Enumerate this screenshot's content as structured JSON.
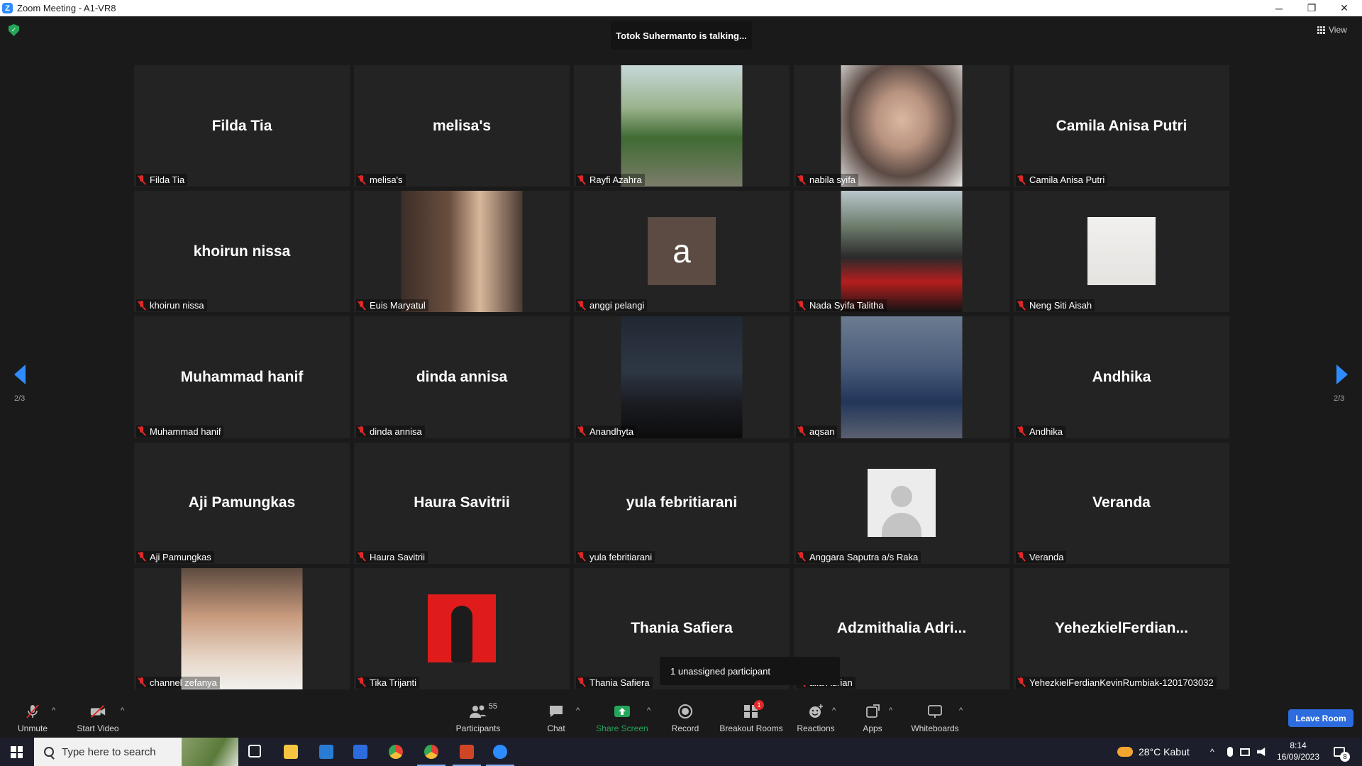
{
  "window": {
    "title": "Zoom Meeting - A1-VR8",
    "minimize_glyph": "─",
    "restore_glyph": "❐",
    "close_glyph": "✕"
  },
  "meeting": {
    "talking_banner": "Totok Suhermanto is talking...",
    "view_label": "View",
    "page_left": "2/3",
    "page_right": "2/3",
    "unassigned_popup": "1 unassigned participant"
  },
  "participants": [
    {
      "display": "Filda Tia",
      "name": "Filda Tia",
      "kind": "text"
    },
    {
      "display": "melisa's",
      "name": "melisa's",
      "kind": "text"
    },
    {
      "display": "",
      "name": "Rayfi Azahra",
      "kind": "photo",
      "style": "garden"
    },
    {
      "display": "",
      "name": "nabila syifa",
      "kind": "photo",
      "style": "glasses"
    },
    {
      "display": "Camila Anisa Putri",
      "name": "Camila Anisa Putri",
      "kind": "text"
    },
    {
      "display": "khoirun nissa",
      "name": "khoirun nissa",
      "kind": "text"
    },
    {
      "display": "",
      "name": "Euis Maryatul",
      "kind": "photo",
      "style": "sidewoman"
    },
    {
      "display": "a",
      "name": "anggi pelangi",
      "kind": "avatar"
    },
    {
      "display": "",
      "name": "Nada Syifa Talitha",
      "kind": "photo",
      "style": "ferrari"
    },
    {
      "display": "",
      "name": "Neng Siti Aisah",
      "kind": "small",
      "style": "tinyfig"
    },
    {
      "display": "Muhammad hanif",
      "name": "Muhammad hanif",
      "kind": "text"
    },
    {
      "display": "dinda annisa",
      "name": "dinda annisa",
      "kind": "text"
    },
    {
      "display": "",
      "name": "Anandhyta",
      "kind": "photo",
      "style": "night"
    },
    {
      "display": "",
      "name": "aqsan",
      "kind": "photo",
      "style": "duck"
    },
    {
      "display": "Andhika",
      "name": "Andhika",
      "kind": "text"
    },
    {
      "display": "Aji Pamungkas",
      "name": "Aji Pamungkas",
      "kind": "text"
    },
    {
      "display": "Haura Savitrii",
      "name": "Haura Savitrii",
      "kind": "text"
    },
    {
      "display": "yula febritiarani",
      "name": "yula febritiarani",
      "kind": "text"
    },
    {
      "display": "",
      "name": "Anggara Saputra a/s Raka",
      "kind": "small",
      "style": "silhouette"
    },
    {
      "display": "Veranda",
      "name": "Veranda",
      "kind": "text"
    },
    {
      "display": "",
      "name": "channel zefanya",
      "kind": "photo",
      "style": "portrait"
    },
    {
      "display": "",
      "name": "Tika Trijanti",
      "kind": "small",
      "style": "redbg"
    },
    {
      "display": "Thania Safiera",
      "name": "Thania Safiera",
      "kind": "text"
    },
    {
      "display": "Adzmithalia  Adri...",
      "name": "alia Adrian",
      "kind": "text"
    },
    {
      "display": "YehezkielFerdian...",
      "name": "YehezkielFerdianKevinRumbiak-1201703032",
      "kind": "text"
    }
  ],
  "toolbar": {
    "unmute": "Unmute",
    "start_video": "Start Video",
    "participants": "Participants",
    "participants_count": "55",
    "chat": "Chat",
    "share_screen": "Share Screen",
    "record": "Record",
    "breakout_rooms": "Breakout Rooms",
    "breakout_badge": "1",
    "reactions": "Reactions",
    "apps": "Apps",
    "whiteboards": "Whiteboards",
    "leave_room": "Leave Room",
    "caret": "^",
    "colors": {
      "share_green": "#23a55a",
      "leave_blue": "#2d6cdf",
      "accent": "#2d8cff"
    }
  },
  "taskbar": {
    "search_placeholder": "Type here to search",
    "weather": "28°C  Kabut",
    "time": "8:14",
    "date": "16/09/2023",
    "notification_count": "8"
  }
}
